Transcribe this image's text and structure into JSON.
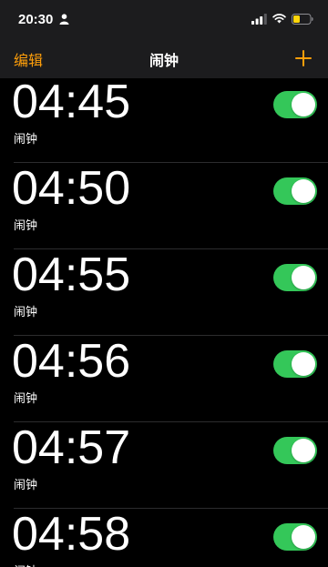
{
  "status_bar": {
    "time": "20:30",
    "icons": [
      "person-icon",
      "signal-icon",
      "wifi-icon",
      "battery-icon"
    ],
    "battery_color": "#ffd60a"
  },
  "nav": {
    "edit_label": "编辑",
    "title": "闹钟",
    "add_icon": "plus-icon"
  },
  "colors": {
    "accent": "#ff9f0a",
    "toggle_on": "#34c759",
    "background": "#000000"
  },
  "alarms": [
    {
      "time": "04:45",
      "label": "闹钟",
      "enabled": true
    },
    {
      "time": "04:50",
      "label": "闹钟",
      "enabled": true
    },
    {
      "time": "04:55",
      "label": "闹钟",
      "enabled": true
    },
    {
      "time": "04:56",
      "label": "闹钟",
      "enabled": true
    },
    {
      "time": "04:57",
      "label": "闹钟",
      "enabled": true
    },
    {
      "time": "04:58",
      "label": "闹钟",
      "enabled": true
    }
  ]
}
